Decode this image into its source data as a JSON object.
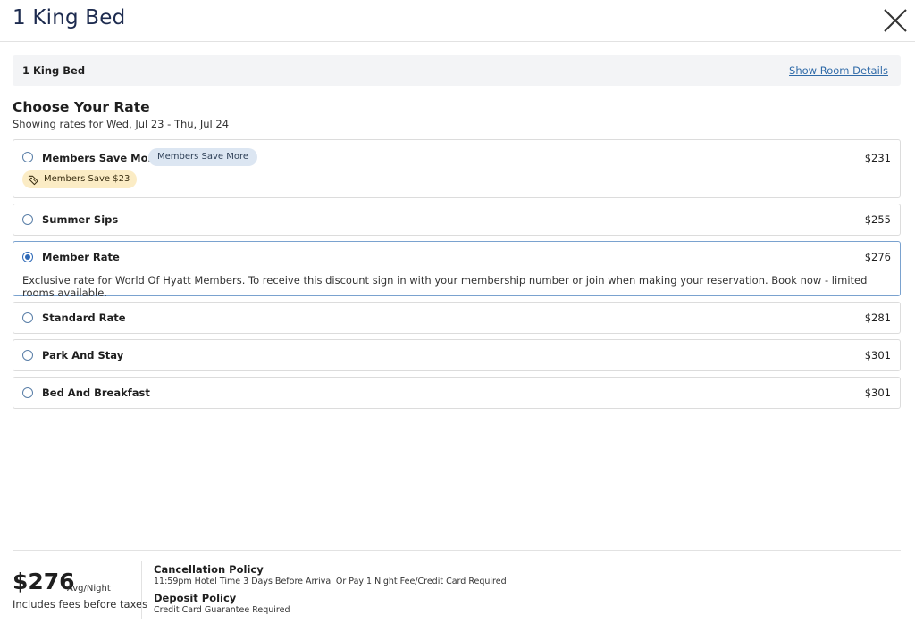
{
  "header": {
    "title": "1 King Bed",
    "close_icon": "close-x-icon"
  },
  "room_bar": {
    "room_name": "1 King Bed",
    "details_link": "Show Room Details"
  },
  "rates_section": {
    "title": "Choose Your Rate",
    "showing": "Showing rates for Wed, Jul 23 - Thu, Jul 24"
  },
  "rates": [
    {
      "name": "Members Save More",
      "price": "$231",
      "selected": false,
      "badge": "Members Save More",
      "savings_badge": "Members Save $23",
      "savings_icon": "price-tag-icon"
    },
    {
      "name": "Summer Sips",
      "price": "$255",
      "selected": false
    },
    {
      "name": "Member Rate",
      "price": "$276",
      "selected": true,
      "description": "Exclusive rate for World Of Hyatt Members. To receive this discount sign in with your membership number or join when making your reservation. Book now - limited rooms available."
    },
    {
      "name": "Standard Rate",
      "price": "$281",
      "selected": false
    },
    {
      "name": "Park And Stay",
      "price": "$301",
      "selected": false
    },
    {
      "name": "Bed And Breakfast",
      "price": "$301",
      "selected": false
    }
  ],
  "footer": {
    "price": "$276",
    "price_unit": "Avg/Night",
    "price_note": "Includes fees before taxes",
    "cancellation_title": "Cancellation Policy",
    "cancellation_text": "11:59pm Hotel Time 3 Days Before Arrival Or Pay 1 Night Fee/Credit Card Required",
    "deposit_title": "Deposit Policy",
    "deposit_text": "Credit Card Guarantee Required"
  },
  "colors": {
    "title": "#1d2b4f",
    "link": "#2f6aa8",
    "selected_border": "#7aa2cf",
    "radio": "#2f6ab8",
    "badge_blue_bg": "#dce6f2",
    "badge_save_bg": "#fbecc5"
  }
}
